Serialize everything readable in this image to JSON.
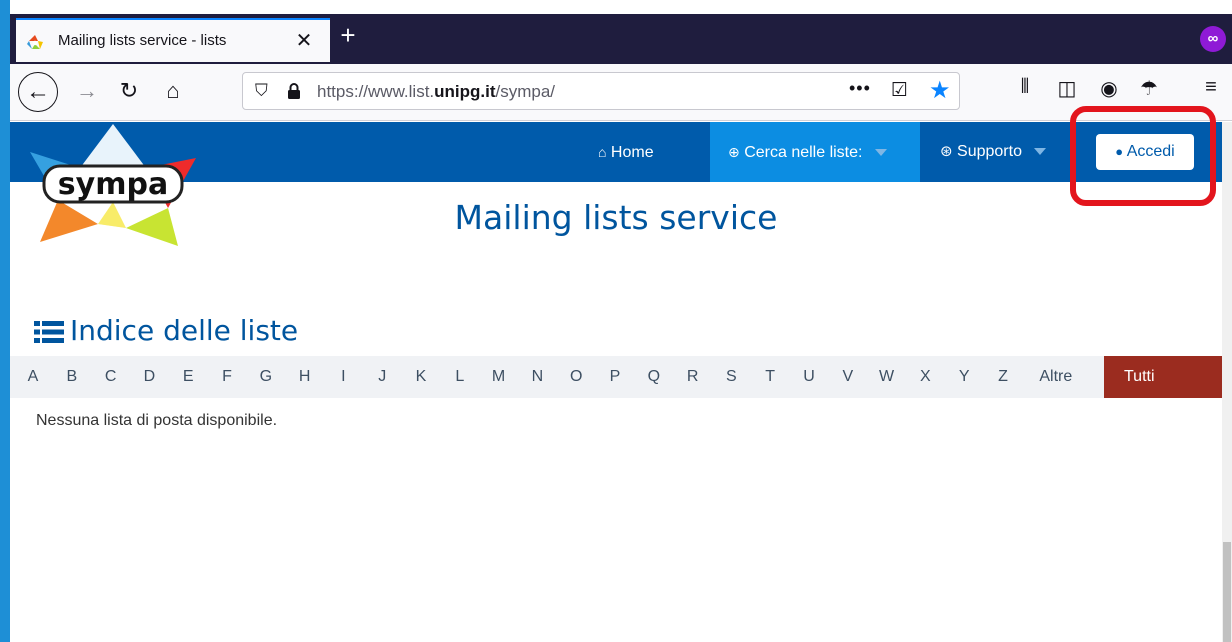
{
  "browser": {
    "tab_title": "Mailing lists service - lists",
    "tab_close": "✕",
    "new_tab": "+",
    "url_prefix": "https://www.list.",
    "url_domain": "unipg.it",
    "url_suffix": "/sympa/",
    "more": "•••"
  },
  "site": {
    "title": "Mailing lists service",
    "nav": {
      "home": "Home",
      "search": "Cerca nelle liste:",
      "support": "Supporto",
      "login": "Accedi"
    },
    "logo_text": "sympa",
    "index_heading": "Indice delle liste",
    "letters": [
      "A",
      "B",
      "C",
      "D",
      "E",
      "F",
      "G",
      "H",
      "I",
      "J",
      "K",
      "L",
      "M",
      "N",
      "O",
      "P",
      "Q",
      "R",
      "S",
      "T",
      "U",
      "V",
      "W",
      "X",
      "Y",
      "Z",
      "Altre"
    ],
    "all_label": "Tutti",
    "empty_message": "Nessuna lista di posta disponibile."
  },
  "colors": {
    "navbar": "#005bab",
    "nav_active": "#0c8de2",
    "all_button": "#9b2c1f",
    "annotation": "#e3151d"
  }
}
